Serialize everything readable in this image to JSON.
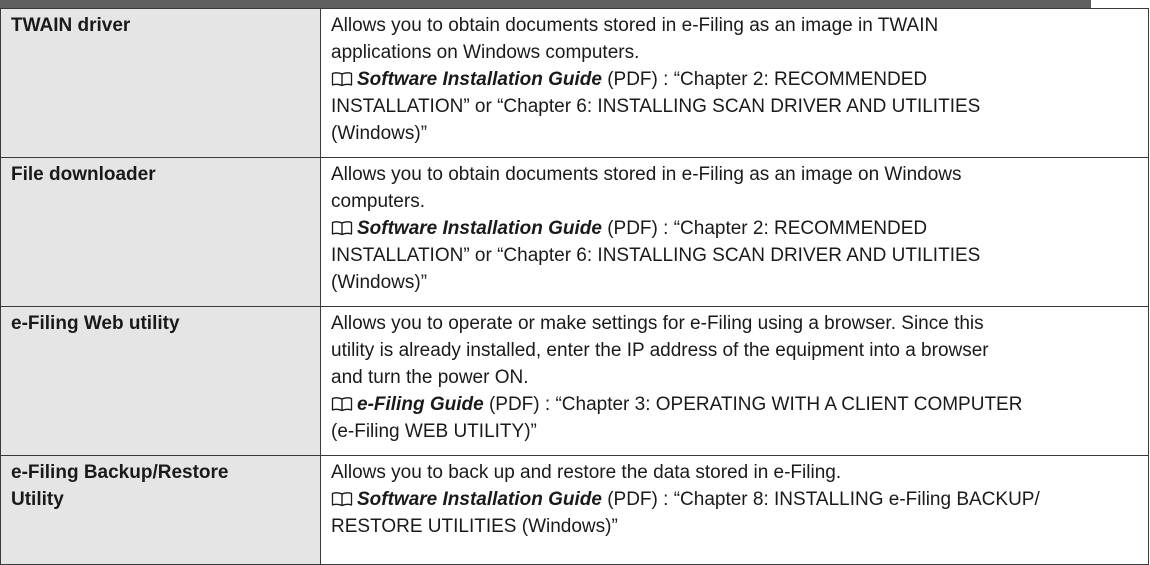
{
  "rows": [
    {
      "label": "TWAIN driver",
      "description": "Allows you to obtain documents stored in e-Filing as an image in TWAIN\napplications on Windows computers.",
      "ref_icon": "book-icon",
      "ref_guide": "Software Installation Guide",
      "ref_format": "(PDF)",
      "ref_chapter": "“Chapter 2: RECOMMENDED\nINSTALLATION” or “Chapter 6: INSTALLING SCAN DRIVER AND UTILITIES\n(Windows)”"
    },
    {
      "label": "File downloader",
      "description": "Allows you to obtain documents stored in e-Filing as an image on Windows\ncomputers.",
      "ref_icon": "book-icon",
      "ref_guide": "Software Installation Guide",
      "ref_format": "(PDF)",
      "ref_chapter": "“Chapter 2: RECOMMENDED\nINSTALLATION” or “Chapter 6: INSTALLING SCAN DRIVER AND UTILITIES\n(Windows)”"
    },
    {
      "label": "e-Filing Web utility",
      "description": "Allows you to operate or make settings for e-Filing using a browser. Since this\nutility is already installed, enter the IP address of the equipment into a browser\nand turn the power ON.",
      "ref_icon": "book-icon",
      "ref_guide": "e-Filing Guide",
      "ref_format": "(PDF)",
      "ref_chapter": "“Chapter 3: OPERATING WITH A CLIENT COMPUTER\n(e-Filing WEB UTILITY)”"
    },
    {
      "label": "e-Filing Backup/Restore\nUtility",
      "description": "Allows you to back up and restore the data stored in e-Filing.",
      "ref_icon": "book-icon",
      "ref_guide": "Software Installation Guide",
      "ref_format": "(PDF)",
      "ref_chapter": "“Chapter 8: INSTALLING e-Filing BACKUP/\nRESTORE UTILITIES (Windows)”"
    }
  ]
}
